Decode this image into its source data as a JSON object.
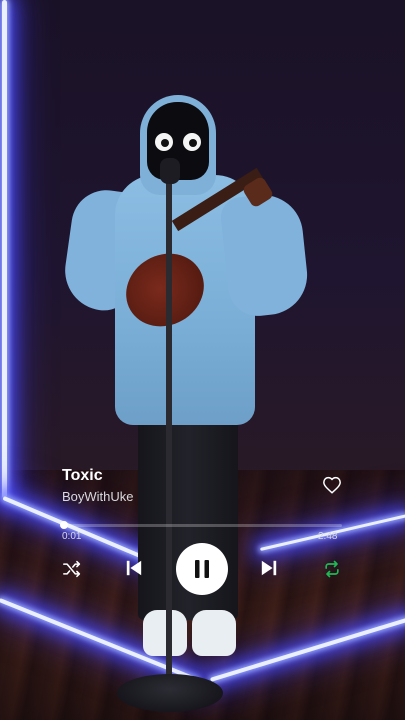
{
  "player": {
    "track_title": "Toxic",
    "artist": "BoyWithUke",
    "elapsed": "0:01",
    "duration": "2:48",
    "progress_fraction": 0.006,
    "liked": false,
    "shuffle_enabled": false,
    "repeat_enabled": true,
    "is_playing": true
  },
  "icons": {
    "like": "heart-outline-icon",
    "shuffle": "shuffle-icon",
    "previous": "skip-previous-icon",
    "play_pause": "pause-icon",
    "next": "skip-next-icon",
    "repeat": "repeat-icon"
  },
  "colors": {
    "accent": "#1db954",
    "text_primary": "#ffffff",
    "text_secondary": "#d9d9de",
    "neon": "#4a4dff"
  }
}
